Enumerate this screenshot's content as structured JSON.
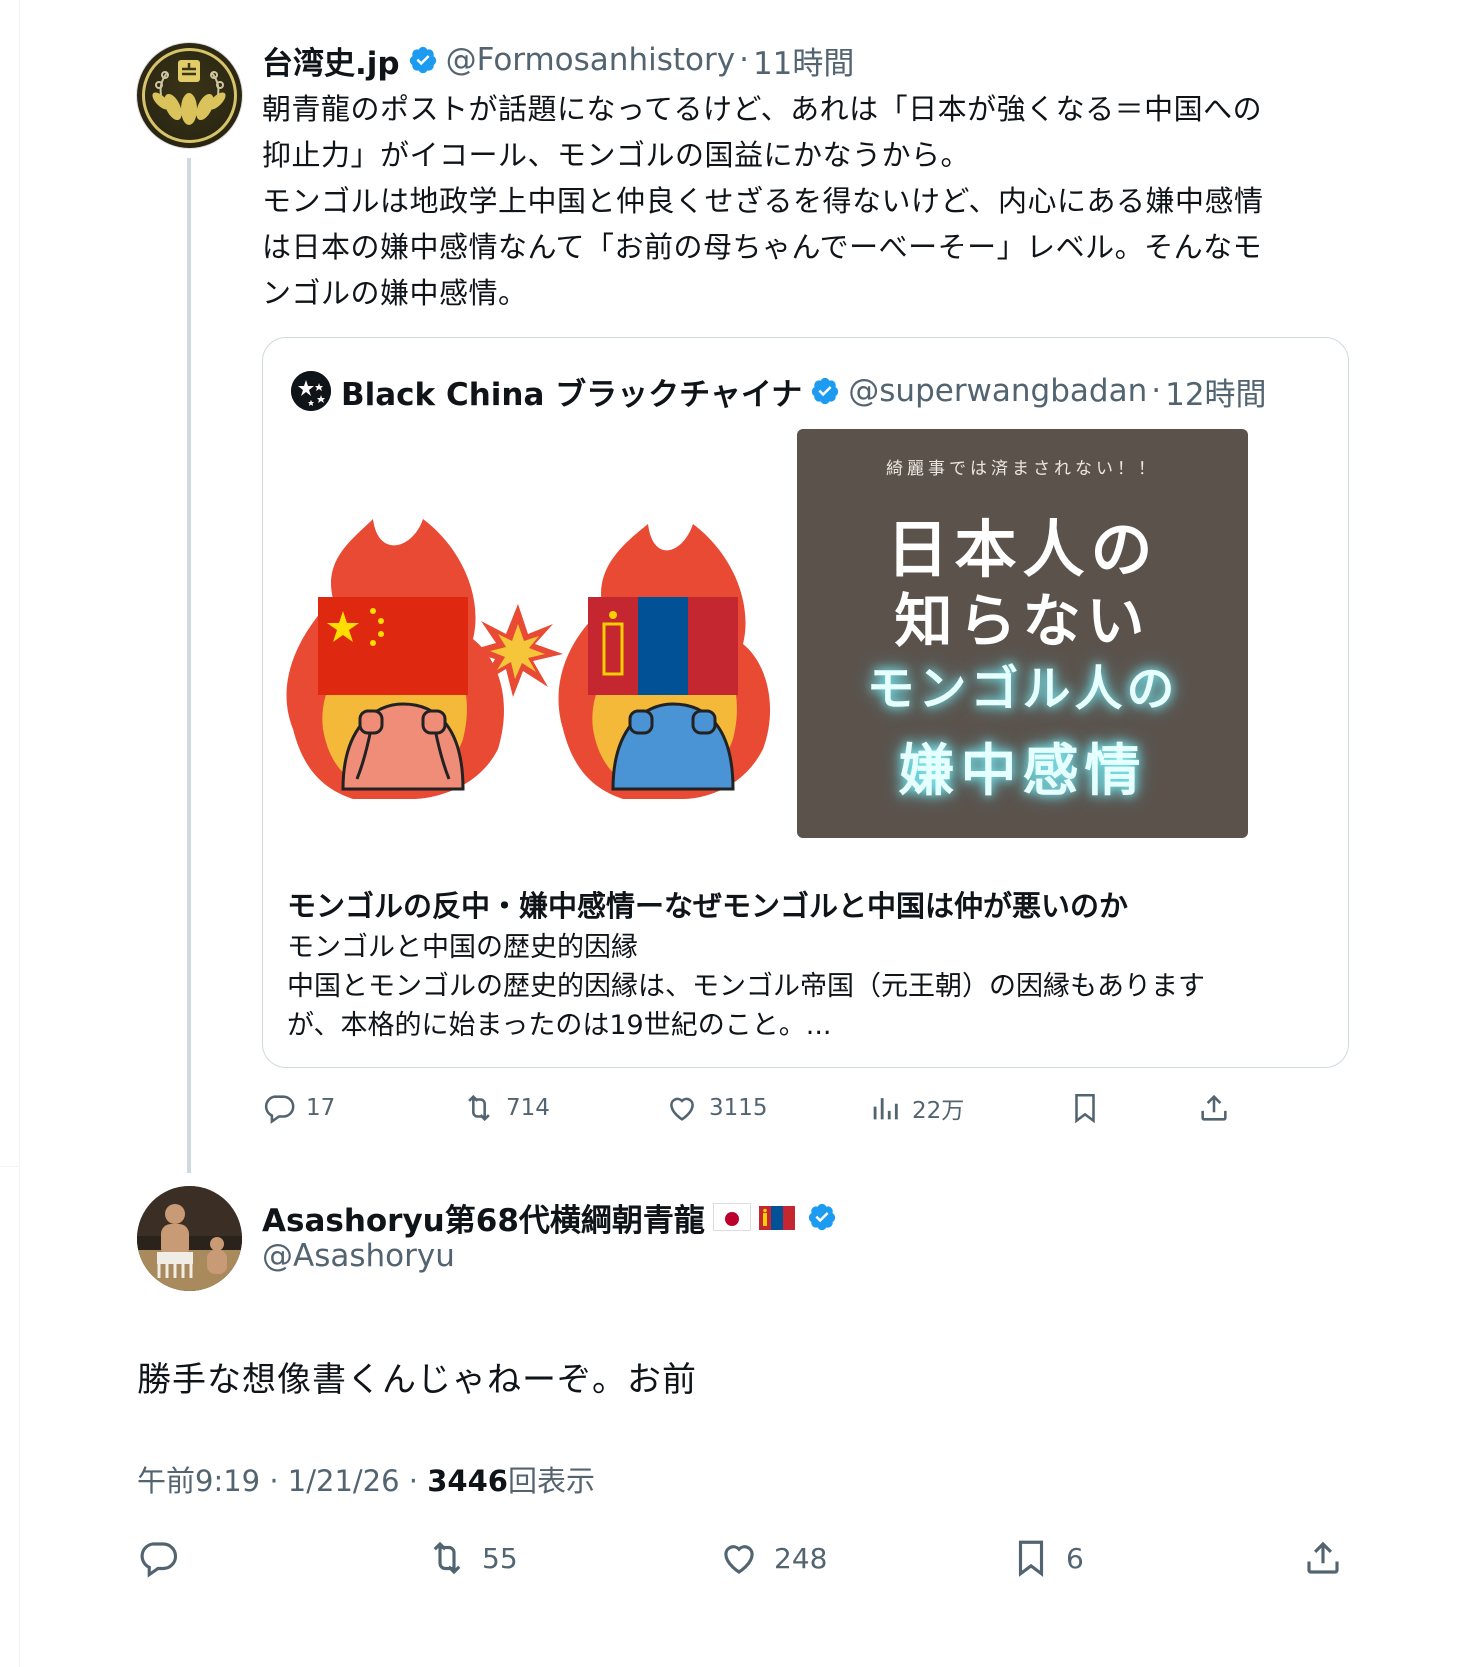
{
  "parent_tweet": {
    "display_name": "台湾史.jp",
    "handle": "@Formosanhistory",
    "time": "11時間",
    "text": "朝青龍のポストが話題になってるけど、あれは「日本が強くなる＝中国への\n抑止力」がイコール、モンゴルの国益にかなうから。\nモンゴルは地政学上中国と仲良くせざるを得ないけど、内心にある嫌中感情\nは日本の嫌中感情なんて「お前の母ちゃんでーべーそー」レベル。そんなモ\nンゴルの嫌中感情。",
    "quote": {
      "display_name": "Black China ブラックチャイナ",
      "handle": "@superwangbadan",
      "time": "12時間",
      "image": {
        "kicker": "綺麗事では済まされない！！",
        "line1": "日本人の",
        "line2": "知らない",
        "line3": "モンゴル人の",
        "line4": "嫌中感情"
      },
      "card_title": "モンゴルの反中・嫌中感情ーなぜモンゴルと中国は仲が悪いのか",
      "card_description": "モンゴルと中国の歴史的因縁\n中国とモンゴルの歴史的因縁は、モンゴル帝国（元王朝）の因縁もあります\nが、本格的に始まったのは19世紀のこと。..."
    },
    "actions": {
      "replies": "17",
      "reposts": "714",
      "likes": "3115",
      "views": "22万"
    }
  },
  "main_tweet": {
    "display_name": "Asashoryu第68代横綱朝青龍",
    "handle": "@Asashoryu",
    "text": "勝手な想像書くんじゃねーぞ。お前",
    "time": "午前9:19",
    "date": "1/21/26",
    "view_count": "3446",
    "view_label": "回表示",
    "actions": {
      "reposts": "55",
      "likes": "248",
      "bookmarks": "6"
    }
  },
  "colors": {
    "verified": "#1d9bf0",
    "secondary_text": "#536471",
    "thread_line": "#cfd9de",
    "image_panel": "#5b524c"
  },
  "separators": {
    "dot": "·"
  }
}
